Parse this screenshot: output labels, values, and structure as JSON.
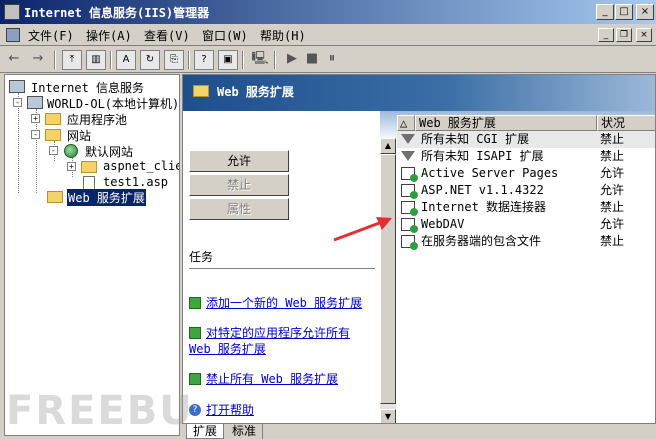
{
  "window": {
    "title": "Internet 信息服务(IIS)管理器",
    "controls": {
      "minimize": "_",
      "maximize": "□",
      "close": "×"
    }
  },
  "menu": {
    "items": [
      "文件(F)",
      "操作(A)",
      "查看(V)",
      "窗口(W)",
      "帮助(H)"
    ],
    "mdi_controls": {
      "minimize": "_",
      "restore": "❐",
      "close": "×"
    }
  },
  "toolbar": {
    "back": "←",
    "forward": "→",
    "up": "⤒",
    "show_tree": "▥",
    "properties": "A",
    "refresh": "↻",
    "export": "⎘",
    "help": "?",
    "console": "▣",
    "server": "🖳",
    "start": "▶",
    "stop": "■",
    "pause": "⏸"
  },
  "tree": {
    "root": "Internet 信息服务",
    "computer": "WORLD-OL(本地计算机)",
    "app_pools": "应用程序池",
    "websites": "网站",
    "default_site": "默认网站",
    "aspnet_client": "aspnet_clier",
    "test_file": "test1.asp",
    "web_ext": "Web 服务扩展",
    "expanders": {
      "plus": "+",
      "minus": "-"
    }
  },
  "right_pane": {
    "header_title": "Web 服务扩展",
    "buttons": {
      "allow": "允许",
      "prohibit": "禁止",
      "properties": "属性"
    },
    "tasks_label": "任务",
    "tasks": [
      {
        "line1": "添加一个新的 Web 服务扩展"
      },
      {
        "line1": "对特定的应用程序允许所有",
        "line2": "Web 服务扩展"
      },
      {
        "line1": "禁止所有 Web 服务扩展"
      }
    ],
    "help_link": "打开帮助",
    "help_icon": "?"
  },
  "list": {
    "sort_arrow": "△",
    "columns": [
      "Web 服务扩展",
      "状况"
    ],
    "rows": [
      {
        "icon": "filter-icon",
        "name": "所有未知 CGI 扩展",
        "status": "禁止"
      },
      {
        "icon": "filter-icon",
        "name": "所有未知 ISAPI 扩展",
        "status": "禁止"
      },
      {
        "icon": "extension-icon",
        "name": "Active Server Pages",
        "status": "允许"
      },
      {
        "icon": "extension-icon",
        "name": "ASP.NET v1.1.4322",
        "status": "允许"
      },
      {
        "icon": "extension-icon",
        "name": "Internet 数据连接器",
        "status": "禁止"
      },
      {
        "icon": "extension-icon",
        "name": "WebDAV",
        "status": "允许"
      },
      {
        "icon": "extension-icon",
        "name": "在服务器端的包含文件",
        "status": "禁止"
      }
    ]
  },
  "scroll": {
    "up": "▲",
    "down": "▼"
  },
  "tabs": [
    "扩展",
    "标准"
  ],
  "annotation_color": "#e03030",
  "watermark": "FREEBU"
}
